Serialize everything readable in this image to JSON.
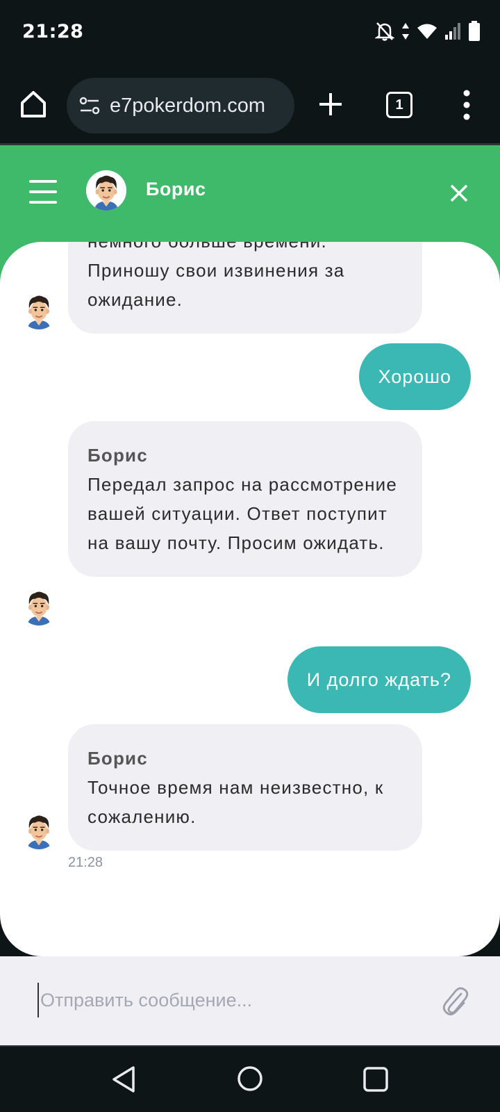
{
  "status_bar": {
    "time": "21:28"
  },
  "browser": {
    "url": "e7pokerdom.com",
    "tab_count": "1"
  },
  "chat": {
    "agent_name": "Борис",
    "messages": [
      {
        "from": "agent",
        "sender": "",
        "text": "немного больше времени. Приношу свои извинения за ожидание."
      },
      {
        "from": "user",
        "text": "Хорошо"
      },
      {
        "from": "agent",
        "sender": "Борис",
        "text": "Передал запрос на рассмотрение вашей ситуации. Ответ поступит на вашу почту. Просим ожидать."
      },
      {
        "from": "user",
        "text": "И долго ждать?"
      },
      {
        "from": "agent",
        "sender": "Борис",
        "text": "Точное время нам неизвестно, к сожалению.",
        "time": "21:28"
      }
    ]
  },
  "input": {
    "placeholder": "Отправить сообщение..."
  },
  "colors": {
    "header_green": "#3fba6a",
    "user_bubble": "#3cb8b4",
    "agent_bubble": "#f0f0f4"
  },
  "icons": [
    "home-icon",
    "tune-icon",
    "plus-icon",
    "tabs-icon",
    "more-vert-icon",
    "menu-icon",
    "close-icon",
    "attach-icon",
    "nav-back-icon",
    "nav-home-icon",
    "nav-recent-icon"
  ]
}
